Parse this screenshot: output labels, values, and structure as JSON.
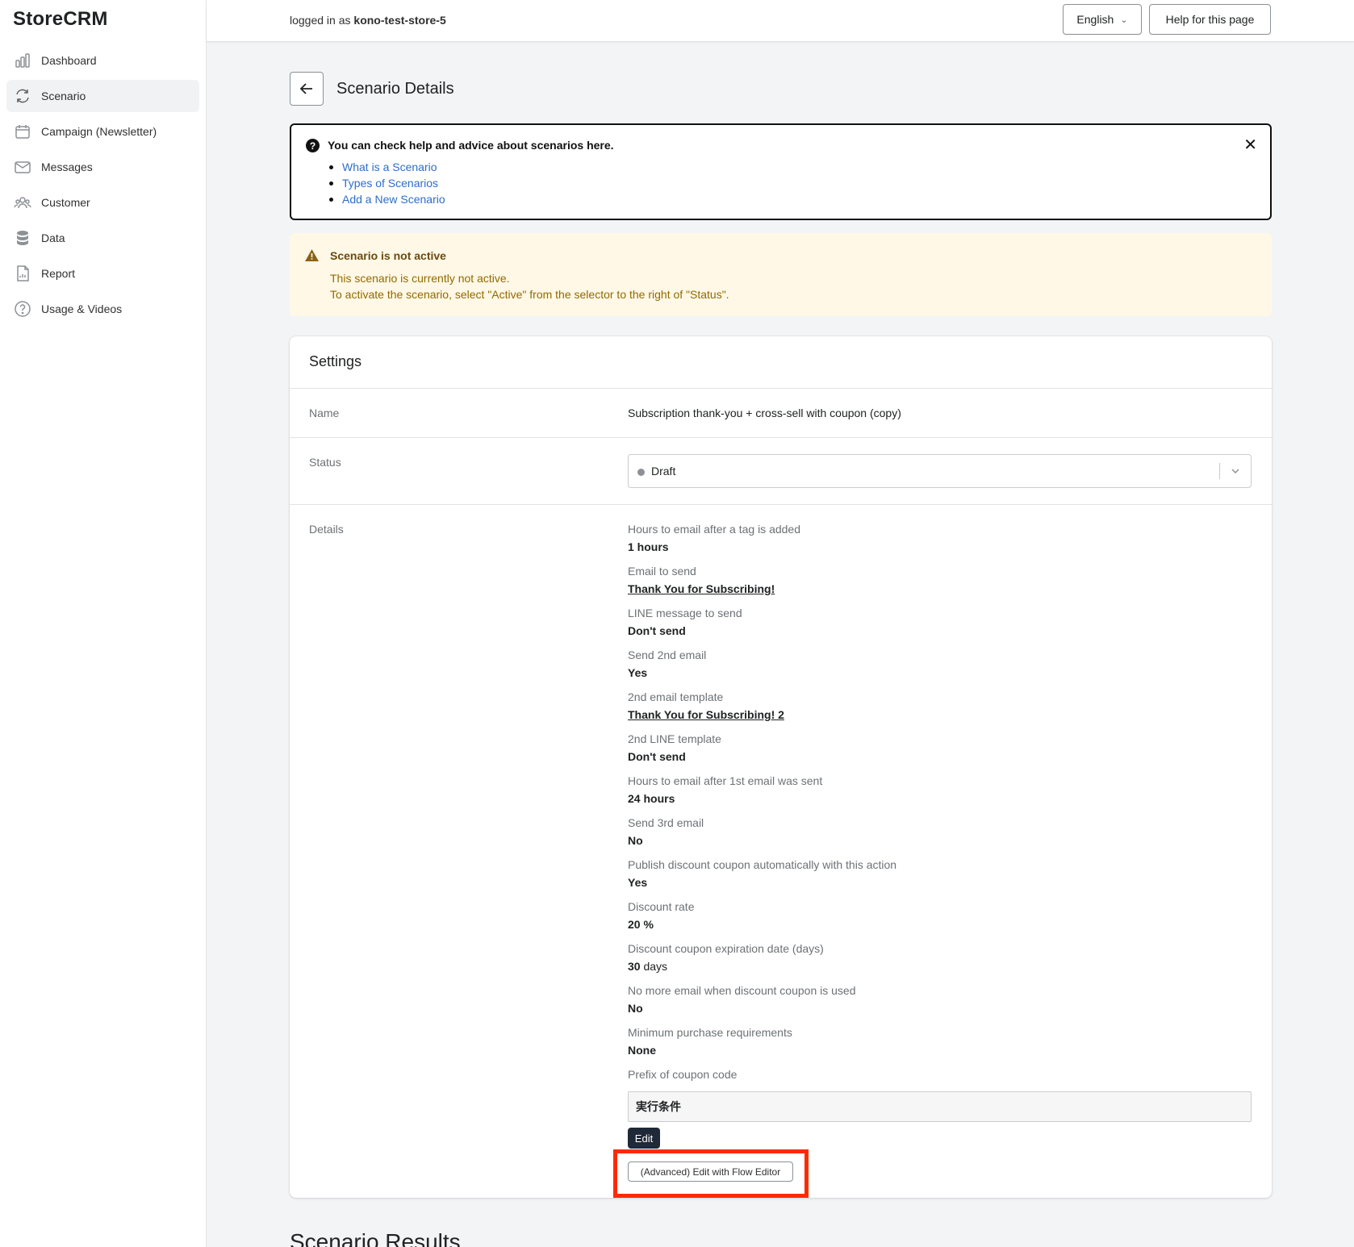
{
  "app": {
    "name": "StoreCRM"
  },
  "sidebar": {
    "items": [
      {
        "label": "Dashboard",
        "icon": "bar-chart-icon",
        "active": false
      },
      {
        "label": "Scenario",
        "icon": "refresh-icon",
        "active": true
      },
      {
        "label": "Campaign (Newsletter)",
        "icon": "calendar-icon",
        "active": false
      },
      {
        "label": "Messages",
        "icon": "mail-icon",
        "active": false
      },
      {
        "label": "Customer",
        "icon": "customers-icon",
        "active": false
      },
      {
        "label": "Data",
        "icon": "database-icon",
        "active": false
      },
      {
        "label": "Report",
        "icon": "report-icon",
        "active": false
      },
      {
        "label": "Usage & Videos",
        "icon": "question-circle-icon",
        "active": false
      }
    ]
  },
  "topbar": {
    "logged_prefix": "logged in as",
    "store_name": "kono-test-store-5",
    "language": "English",
    "help_label": "Help for this page"
  },
  "page": {
    "title": "Scenario Details"
  },
  "help_banner": {
    "heading": "You can check help and advice about scenarios here.",
    "links": [
      "What is a Scenario",
      "Types of Scenarios",
      "Add a New Scenario"
    ]
  },
  "warning": {
    "title": "Scenario is not active",
    "line1": "This scenario is currently not active.",
    "line2": "To activate the scenario, select \"Active\" from the selector to the right of \"Status\"."
  },
  "settings": {
    "title": "Settings",
    "name_label": "Name",
    "name_value": "Subscription thank-you + cross-sell with coupon (copy)",
    "status_label": "Status",
    "status_value": "Draft",
    "details_label": "Details",
    "details": [
      {
        "label": "Hours to email after a tag is added",
        "value": "1 hours",
        "unit": ""
      },
      {
        "label": "Email to send",
        "value": "Thank You for Subscribing!",
        "unit": ""
      },
      {
        "label": "LINE message to send",
        "value": "Don't send",
        "unit": ""
      },
      {
        "label": "Send 2nd email",
        "value": "Yes",
        "unit": ""
      },
      {
        "label": "2nd email template",
        "value": "Thank You for Subscribing! 2",
        "unit": ""
      },
      {
        "label": "2nd LINE template",
        "value": "Don't send",
        "unit": ""
      },
      {
        "label": "Hours to email after 1st email was sent",
        "value": "24 hours",
        "unit": ""
      },
      {
        "label": "Send 3rd email",
        "value": "No",
        "unit": ""
      },
      {
        "label": "Publish discount coupon automatically with this action",
        "value": "Yes",
        "unit": ""
      },
      {
        "label": "Discount rate",
        "value": "20 %",
        "unit": ""
      },
      {
        "label": "Discount coupon expiration date (days)",
        "value": "30",
        "unit": " days"
      },
      {
        "label": "No more email when discount coupon is used",
        "value": "No",
        "unit": ""
      },
      {
        "label": "Minimum purchase requirements",
        "value": "None",
        "unit": ""
      },
      {
        "label": "Prefix of coupon code",
        "value": "",
        "unit": ""
      }
    ],
    "prefix_value": "実行条件",
    "edit_label": "Edit",
    "flow_editor_label": "(Advanced) Edit with Flow Editor"
  },
  "results": {
    "title": "Scenario Results"
  }
}
